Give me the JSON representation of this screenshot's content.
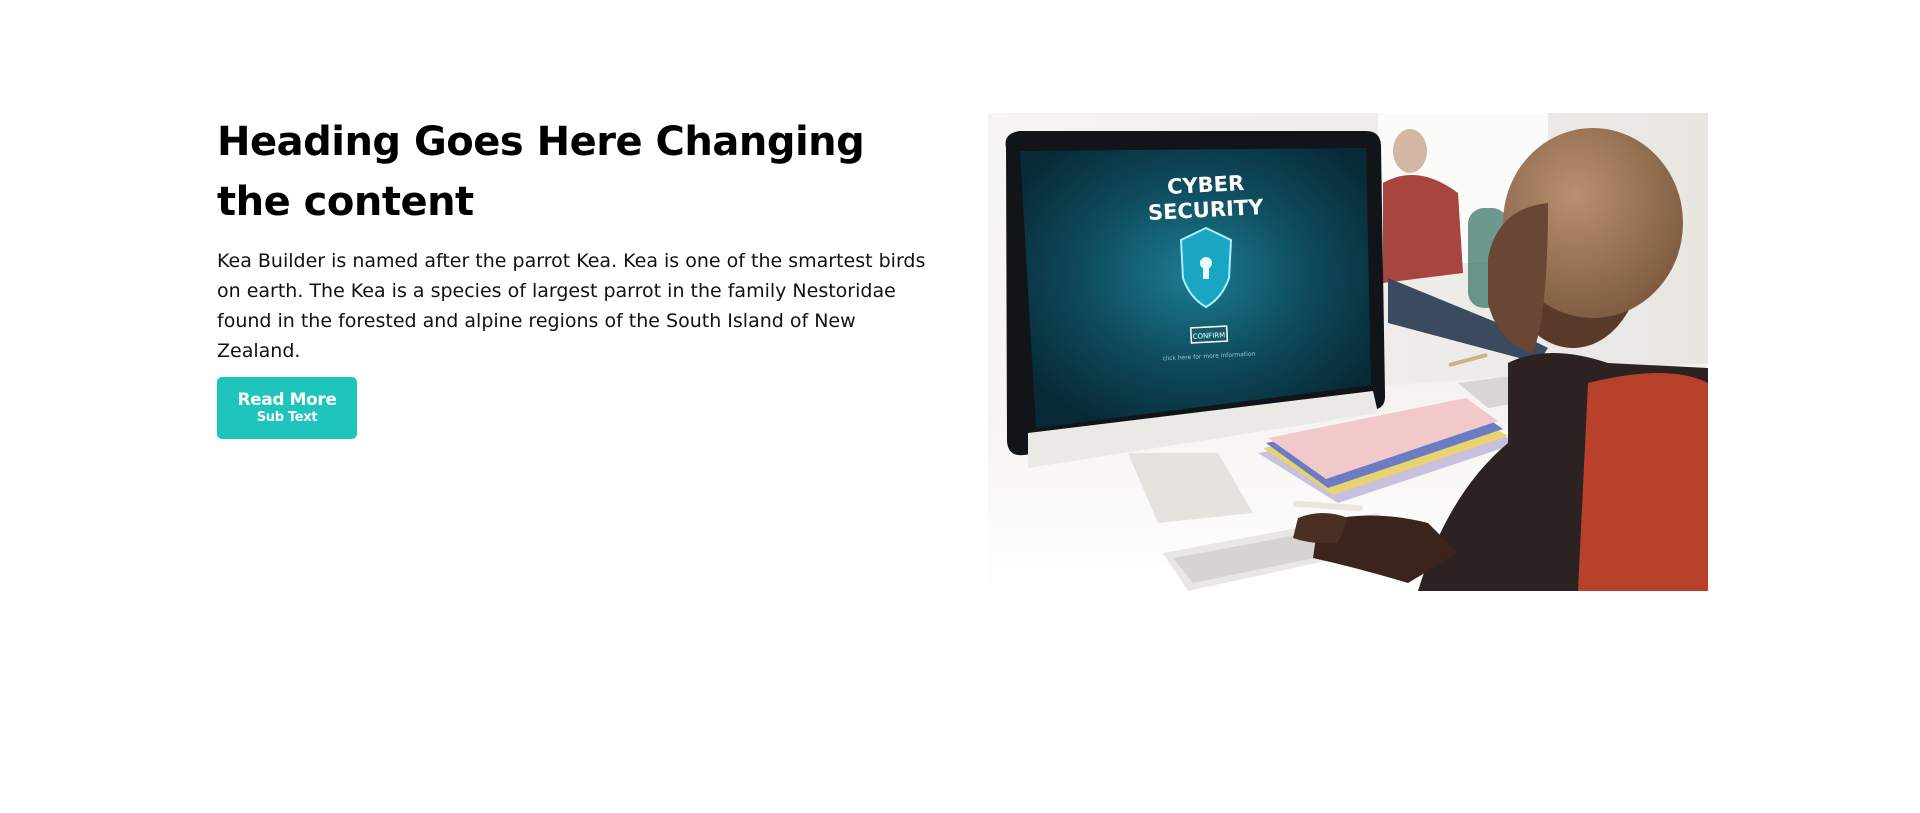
{
  "section": {
    "heading": "Heading Goes Here Changing the content",
    "body": "Kea Builder is named after the parrot Kea. Kea is one of the smartest birds on earth. The Kea is a species of largest parrot in the family Nestoridae found in the forested and alpine regions of the South Island of New Zealand.",
    "button": {
      "label": "Read More",
      "sub_label": "Sub Text",
      "color": "#1fc4bd"
    }
  },
  "image": {
    "screen_title_line1": "CYBER",
    "screen_title_line2": "SECURITY",
    "screen_button": "CONFIRM",
    "screen_caption": "click here for more information"
  }
}
